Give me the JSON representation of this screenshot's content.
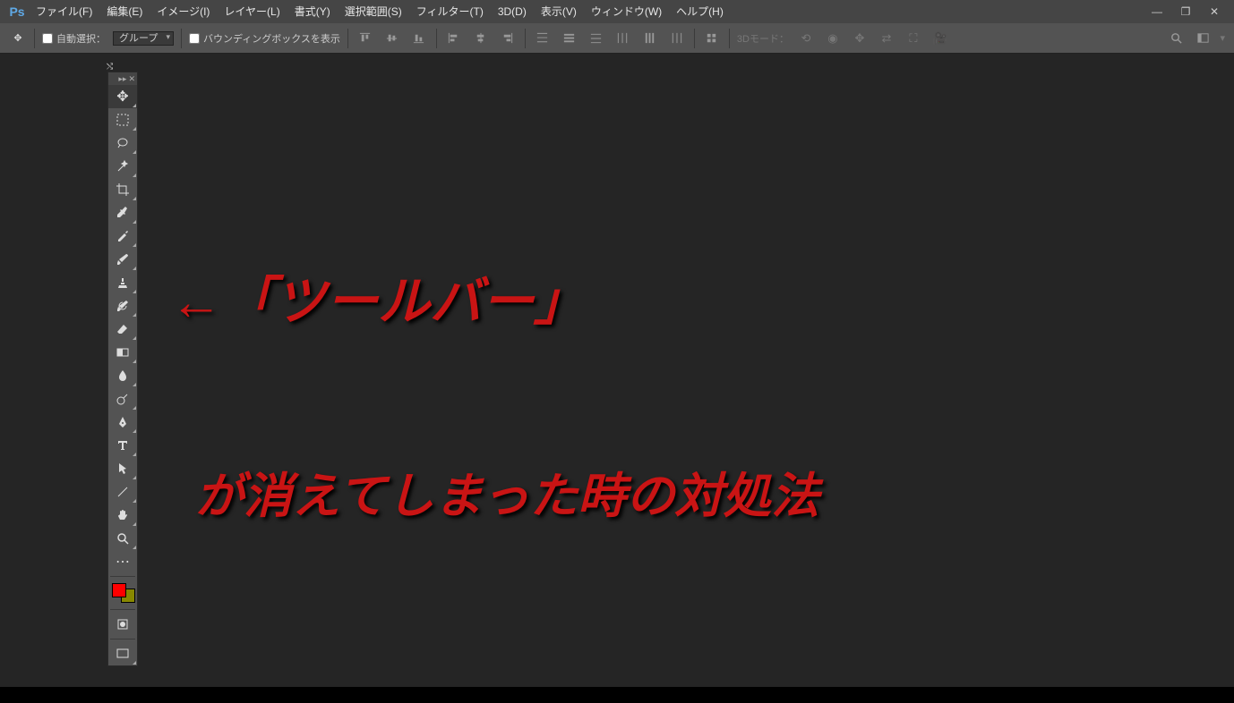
{
  "app": {
    "logo": "Ps"
  },
  "menu": {
    "file": "ファイル(F)",
    "edit": "編集(E)",
    "image": "イメージ(I)",
    "layer": "レイヤー(L)",
    "type": "書式(Y)",
    "select": "選択範囲(S)",
    "filter": "フィルター(T)",
    "threeD": "3D(D)",
    "view": "表示(V)",
    "window": "ウィンドウ(W)",
    "help": "ヘルプ(H)"
  },
  "optionsBar": {
    "autoSelectLabel": "自動選択：",
    "dropdownValue": "グループ",
    "showBoundingBox": "バウンディングボックスを表示",
    "mode3dLabel": "3Dモード："
  },
  "toolbar": {
    "move": "move-tool",
    "marquee": "marquee-tool",
    "lasso": "lasso-tool",
    "wand": "magic-wand-tool",
    "crop": "crop-tool",
    "eyedropper": "eyedropper-tool",
    "heal": "healing-brush-tool",
    "brush": "brush-tool",
    "stamp": "clone-stamp-tool",
    "history": "history-brush-tool",
    "eraser": "eraser-tool",
    "gradient": "gradient-tool",
    "blur": "blur-tool",
    "dodge": "dodge-tool",
    "pen": "pen-tool",
    "type": "type-tool",
    "path": "path-selection-tool",
    "line": "line-tool",
    "hand": "hand-tool",
    "zoom": "zoom-tool"
  },
  "swatch": {
    "fg": "#ff0000",
    "bg": "#888800"
  },
  "annotations": {
    "line1": "←「ツールバー」",
    "line2": "が消えてしまった時の対処法"
  }
}
